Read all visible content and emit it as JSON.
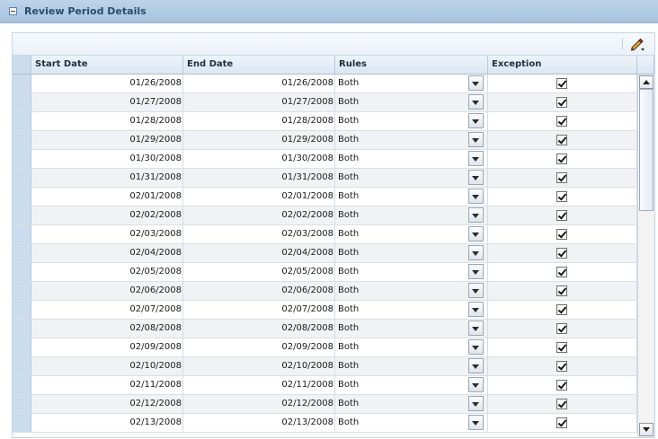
{
  "panel": {
    "title": "Review Period Details"
  },
  "table": {
    "columns": {
      "start": "Start Date",
      "end": "End Date",
      "rules": "Rules",
      "exception": "Exception"
    },
    "rows": [
      {
        "start": "01/26/2008",
        "end": "01/26/2008",
        "rules": "Both",
        "exception": true
      },
      {
        "start": "01/27/2008",
        "end": "01/27/2008",
        "rules": "Both",
        "exception": true
      },
      {
        "start": "01/28/2008",
        "end": "01/28/2008",
        "rules": "Both",
        "exception": true
      },
      {
        "start": "01/29/2008",
        "end": "01/29/2008",
        "rules": "Both",
        "exception": true
      },
      {
        "start": "01/30/2008",
        "end": "01/30/2008",
        "rules": "Both",
        "exception": true
      },
      {
        "start": "01/31/2008",
        "end": "01/31/2008",
        "rules": "Both",
        "exception": true
      },
      {
        "start": "02/01/2008",
        "end": "02/01/2008",
        "rules": "Both",
        "exception": true
      },
      {
        "start": "02/02/2008",
        "end": "02/02/2008",
        "rules": "Both",
        "exception": true
      },
      {
        "start": "02/03/2008",
        "end": "02/03/2008",
        "rules": "Both",
        "exception": true
      },
      {
        "start": "02/04/2008",
        "end": "02/04/2008",
        "rules": "Both",
        "exception": true
      },
      {
        "start": "02/05/2008",
        "end": "02/05/2008",
        "rules": "Both",
        "exception": true
      },
      {
        "start": "02/06/2008",
        "end": "02/06/2008",
        "rules": "Both",
        "exception": true
      },
      {
        "start": "02/07/2008",
        "end": "02/07/2008",
        "rules": "Both",
        "exception": true
      },
      {
        "start": "02/08/2008",
        "end": "02/08/2008",
        "rules": "Both",
        "exception": true
      },
      {
        "start": "02/09/2008",
        "end": "02/09/2008",
        "rules": "Both",
        "exception": true
      },
      {
        "start": "02/10/2008",
        "end": "02/10/2008",
        "rules": "Both",
        "exception": true
      },
      {
        "start": "02/11/2008",
        "end": "02/11/2008",
        "rules": "Both",
        "exception": true
      },
      {
        "start": "02/12/2008",
        "end": "02/12/2008",
        "rules": "Both",
        "exception": true
      },
      {
        "start": "02/13/2008",
        "end": "02/13/2008",
        "rules": "Both",
        "exception": true
      }
    ]
  }
}
